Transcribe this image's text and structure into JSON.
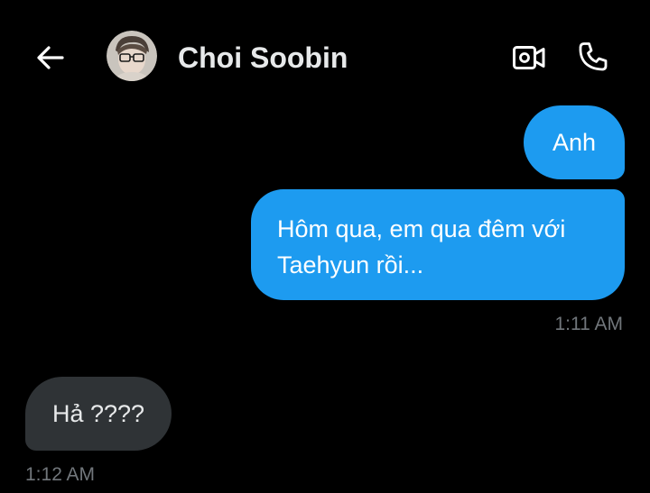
{
  "header": {
    "contact_name": "Choi Soobin",
    "icons": {
      "back": "back-arrow-icon",
      "video": "video-call-icon",
      "phone": "phone-call-icon"
    }
  },
  "messages": [
    {
      "direction": "outgoing",
      "text": "Anh"
    },
    {
      "direction": "outgoing",
      "text": "Hôm qua, em qua đêm với Taehyun rồi..."
    },
    {
      "direction": "incoming",
      "text": "Hả ????"
    }
  ],
  "timestamps": {
    "outgoing_group": "1:11 AM",
    "incoming_group": "1:12 AM"
  },
  "colors": {
    "background": "#000000",
    "outgoing_bubble": "#1d9bf0",
    "incoming_bubble": "#2f3336",
    "timestamp": "#71767b",
    "text": "#e7e9ea"
  }
}
